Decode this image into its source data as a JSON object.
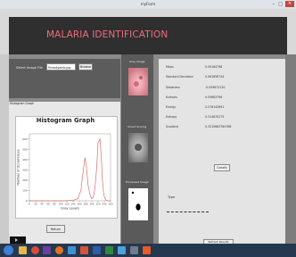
{
  "window": {
    "title": "myForm",
    "minimize": "–",
    "maximize": "□",
    "close": "✕"
  },
  "app": {
    "title": "MALARIA IDENTIFICATION"
  },
  "input_panel": {
    "select_label": "Select Image File",
    "file_value": "P.mediyamb.jpg",
    "browse_label": "Browse"
  },
  "histogram": {
    "caption": "Histogram Graph",
    "return_label": "Return"
  },
  "chart_data": {
    "type": "line",
    "title": "Histogram Graph",
    "xlabel": "Gray Levels",
    "ylabel": "Number of Occurrences",
    "x_ticks": [
      0,
      20,
      40,
      60,
      80,
      100,
      120,
      140,
      160,
      180,
      200,
      220,
      240,
      260
    ],
    "y_ticks": [
      0,
      100,
      200,
      300,
      400,
      500,
      600
    ],
    "xlim": [
      0,
      260
    ],
    "ylim": [
      0,
      650
    ],
    "series": [
      {
        "color": "#e06b6b",
        "x": [
          0,
          60,
          110,
          140,
          155,
          165,
          172,
          178,
          183,
          188,
          195,
          200,
          205,
          210,
          215,
          220,
          226,
          230,
          234,
          238,
          244,
          250,
          260
        ],
        "y": [
          0,
          0,
          0,
          5,
          20,
          100,
          280,
          420,
          320,
          150,
          50,
          20,
          40,
          120,
          300,
          560,
          600,
          450,
          200,
          60,
          10,
          0,
          0
        ]
      }
    ]
  },
  "middle": {
    "gray_label": "Gray Image",
    "binary_label": "Smart Scoring",
    "processed_label": "Processed Image"
  },
  "features": [
    {
      "label": "Mean",
      "value": "0.30164798"
    },
    {
      "label": "Standard Deviation",
      "value": "0.061858744"
    },
    {
      "label": "Skewness",
      "value": "-0.059672120"
    },
    {
      "label": "Kurtosis",
      "value": "0.55683796"
    },
    {
      "label": "Energy",
      "value": "0.278142891"
    },
    {
      "label": "Entropy",
      "value": "0.314870275"
    },
    {
      "label": "Gradient",
      "value": "0.3215683784768"
    }
  ],
  "classify": {
    "label": "Classify"
  },
  "result": {
    "type_label": "Type"
  },
  "reset": {
    "label": "Refresh Results"
  },
  "colors": {
    "accent_title": "#f06b7b",
    "taskbar": "#26384e",
    "histogram_line": "#e06b6b"
  },
  "taskbar": {
    "icons": [
      "start-orb-icon",
      "explorer-icon",
      "chrome-icon",
      "visual-studio-icon",
      "firefox-icon",
      "media-player-icon",
      "powerpoint-icon",
      "word-icon",
      "excel-icon",
      "paint-icon",
      "calculator-icon",
      "matlab-icon"
    ],
    "tray_text": ""
  }
}
